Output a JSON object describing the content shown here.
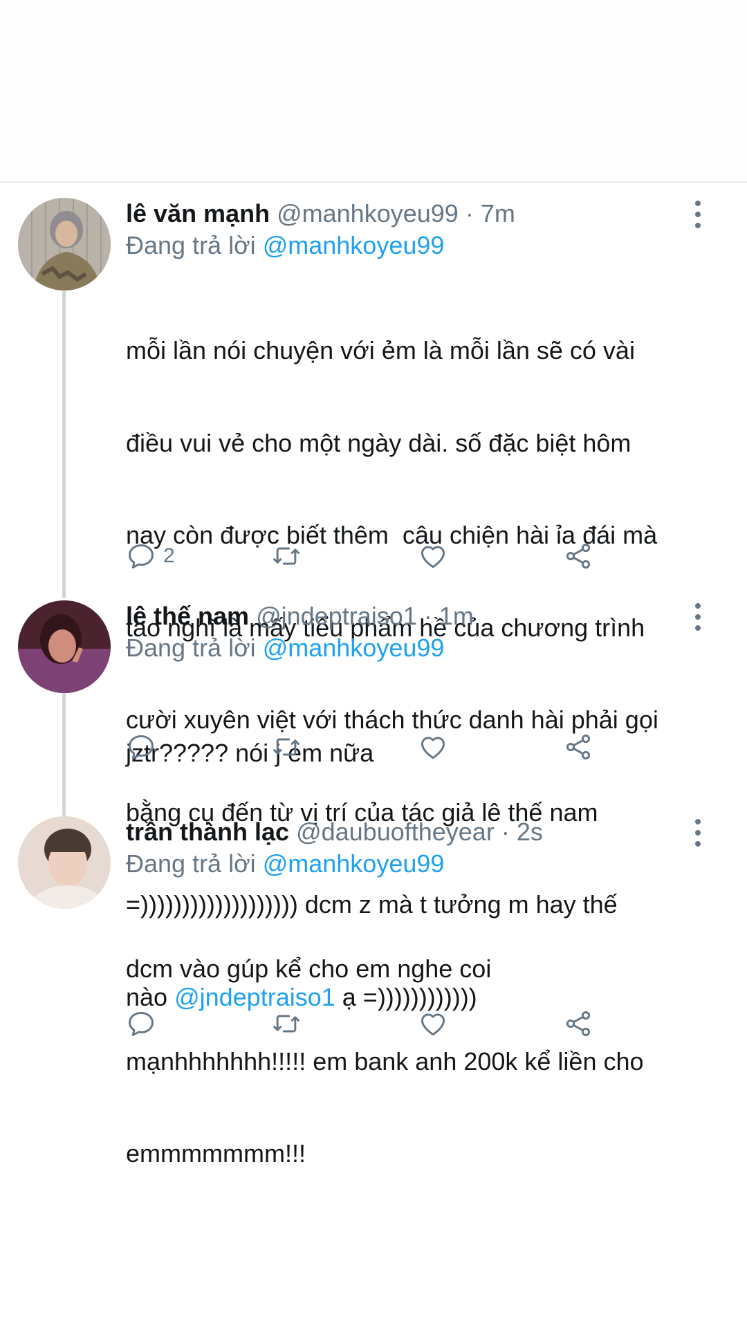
{
  "tweets": [
    {
      "name": "lê văn mạnh",
      "handle": "@manhkoyeu99",
      "separator": "·",
      "time": "7m",
      "reply_prefix": "Đang trả lời",
      "reply_to": "@manhkoyeu99",
      "body_lines": [
        "mỗi lần nói chuyện với ẻm là mỗi lần sẽ có vài",
        "điều vui vẻ cho một ngày dài. số đặc biệt hôm",
        "nay còn được biết thêm  câu chiện hài ỉa đái mà",
        "tao nghĩ là mấy tiểu phẩm hề của chương trình",
        "cười xuyên việt với thách thức danh hài phải gọi",
        "bằng cụ đến từ vị trí của tác giả lê thế nam",
        "=))))))))))))))))))) dcm z mà t tưởng m hay thế"
      ],
      "body_last_prefix": "nào ",
      "body_last_mention": "@jndeptraiso1",
      "body_last_suffix": " ạ =))))))))))))",
      "reply_count": "2",
      "avatar_color": "#8a7a5c"
    },
    {
      "name": "lê thế nam",
      "handle": "@jndeptraiso1",
      "separator": "·",
      "time": "1m",
      "reply_prefix": "Đang trả lời",
      "reply_to": "@manhkoyeu99",
      "body_lines": [
        "jztr????? nói j em nữa"
      ],
      "reply_count": "",
      "avatar_color": "#6b3a4a"
    },
    {
      "name": "trần thành lạc",
      "handle": "@daubuoftheyear",
      "separator": "·",
      "time": "2s",
      "reply_prefix": "Đang trả lời",
      "reply_to": "@manhkoyeu99",
      "body_lines": [
        "dcm vào gúp kể cho em nghe coi",
        "mạnhhhhhhh!!!!! em bank anh 200k kể liền cho",
        "emmmmmmm!!!"
      ],
      "reply_count": "",
      "avatar_color": "#d9c9c0"
    }
  ],
  "icons": {
    "reply": "reply-icon",
    "retweet": "retweet-icon",
    "like": "heart-icon",
    "share": "share-icon",
    "more": "more-vertical-icon"
  },
  "colors": {
    "link": "#1da1f2",
    "secondary_text": "#657786",
    "icon": "#657786",
    "thread_line": "#ccd6dd"
  }
}
